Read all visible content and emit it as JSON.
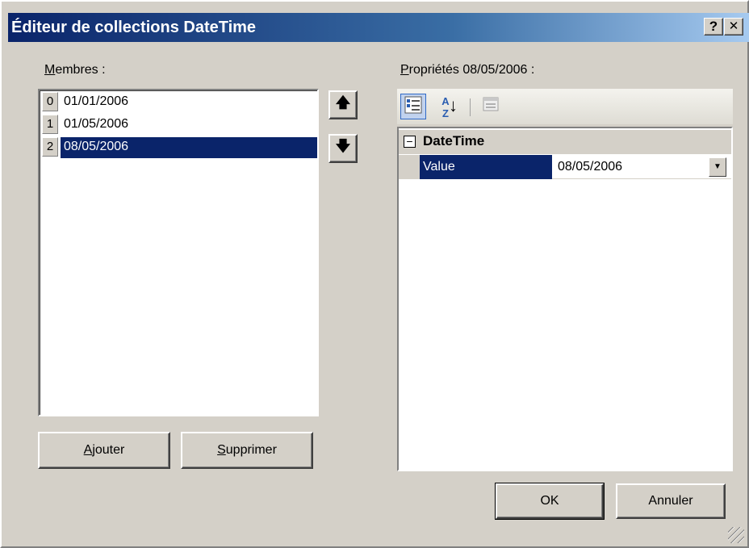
{
  "window": {
    "title": "Éditeur de collections DateTime",
    "help_glyph": "?",
    "close_glyph": "✕"
  },
  "members": {
    "label_first": "M",
    "label_rest": "embres :",
    "items": [
      {
        "index": "0",
        "value": "01/01/2006",
        "selected": false
      },
      {
        "index": "1",
        "value": "01/05/2006",
        "selected": false
      },
      {
        "index": "2",
        "value": "08/05/2006",
        "selected": true
      }
    ]
  },
  "move": {
    "up_glyph": "🡅",
    "down_glyph": "🡇"
  },
  "buttons": {
    "add_first": "A",
    "add_rest": "jouter",
    "remove_first": "S",
    "remove_rest": "upprimer",
    "ok": "OK",
    "cancel": "Annuler"
  },
  "properties": {
    "label_first": "P",
    "label_rest": "ropriétés 08/05/2006 :",
    "toolbar": {
      "categorized_icon": "categorized-icon",
      "alphabetical_icon": "alphabetical-sort-icon",
      "property_pages_icon": "property-pages-icon",
      "alpha_glyph": "A\nZ",
      "down_arrow": "↓"
    },
    "category": {
      "toggle": "−",
      "name": "DateTime"
    },
    "row": {
      "name": "Value",
      "value": "08/05/2006",
      "dropdown_glyph": "▼"
    }
  }
}
